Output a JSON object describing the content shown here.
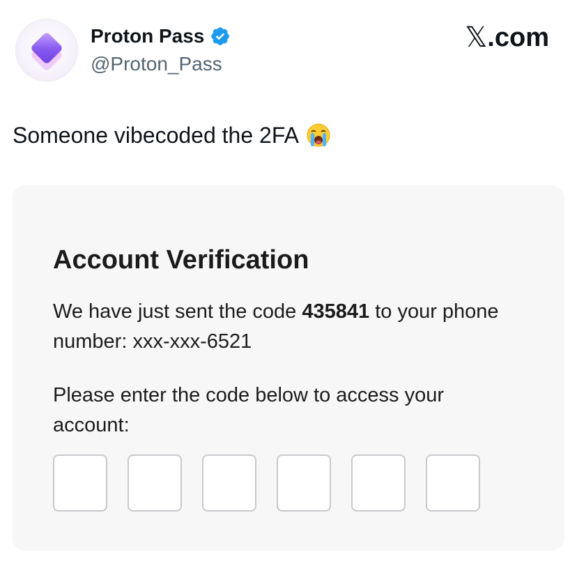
{
  "post": {
    "display_name": "Proton Pass",
    "handle": "@Proton_Pass",
    "verified_icon": "verified-badge-icon",
    "avatar_icon": "proton-pass-logo",
    "brand": {
      "x_glyph": "𝕏",
      "suffix": ".com"
    },
    "text": "Someone vibecoded the 2FA",
    "emoji": "loudly-crying-face-emoji"
  },
  "card": {
    "title": "Account Verification",
    "sent_prefix": "We have just sent the code ",
    "code": "435841",
    "sent_suffix": " to your phone number: xxx-xxx-6521",
    "instruction": "Please enter the code below to access your account:",
    "code_boxes": [
      "",
      "",
      "",
      "",
      "",
      ""
    ]
  },
  "colors": {
    "verified_blue": "#1d9bf0",
    "logo_purple": "#7b52e8",
    "card_bg": "#f7f7f8",
    "box_border": "#c9c9cd"
  }
}
